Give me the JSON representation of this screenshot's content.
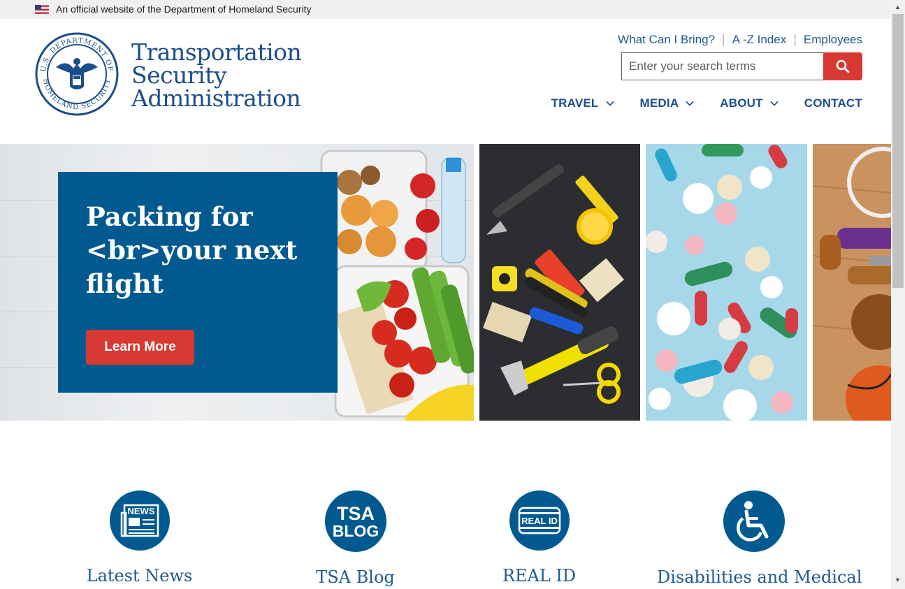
{
  "gov_banner": {
    "text": "An official website of the Department of Homeland Security"
  },
  "logo": {
    "line1": "Transportation",
    "line2": "Security",
    "line3": "Administration",
    "seal_text_top": "U.S. DEPARTMENT OF",
    "seal_text_bottom": "HOMELAND SECURITY"
  },
  "utility_links": [
    "What Can I Bring?",
    "A -Z Index",
    "Employees"
  ],
  "search": {
    "placeholder": "Enter your search terms",
    "value": ""
  },
  "nav": [
    {
      "label": "TRAVEL",
      "icon": "chevron-down-icon"
    },
    {
      "label": "MEDIA",
      "icon": "chevron-down-icon"
    },
    {
      "label": "ABOUT",
      "icon": "chevron-down-icon"
    },
    {
      "label": "CONTACT"
    }
  ],
  "hero": {
    "title": "Packing for <br>your next flight",
    "button": "Learn More"
  },
  "quick_links": [
    {
      "label": "Latest News",
      "icon": "news-icon",
      "icon_text": "NEWS"
    },
    {
      "label": "TSA Blog",
      "icon": "tsa-blog-icon",
      "icon_text_1": "TSA",
      "icon_text_2": "BLOG"
    },
    {
      "label": "REAL ID",
      "icon": "real-id-icon",
      "icon_text": "REAL ID"
    },
    {
      "label": "Disabilities and Medical",
      "icon": "wheelchair-icon"
    }
  ],
  "colors": {
    "brand_blue": "#005a8f",
    "link_blue": "#1c5a93",
    "accent_red": "#d83933",
    "banner_bg": "#f0f0f0"
  }
}
